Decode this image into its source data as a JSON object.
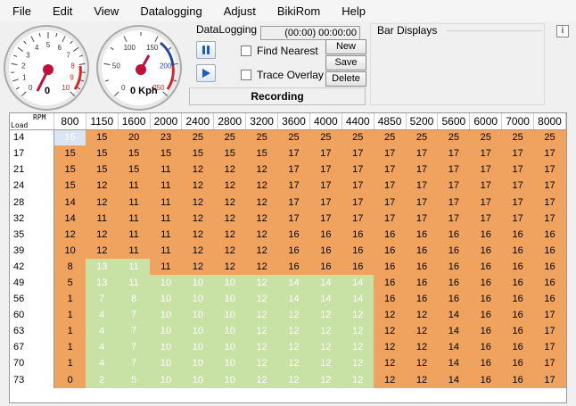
{
  "menu": [
    "File",
    "Edit",
    "View",
    "Datalogging",
    "Adjust",
    "BikiRom",
    "Help"
  ],
  "gauges": {
    "rpm": {
      "value": "0",
      "ticks": [
        "0",
        "1",
        "2",
        "3",
        "4",
        "5",
        "6",
        "7",
        "8",
        "9",
        "10"
      ]
    },
    "speed": {
      "value": "0 Kph",
      "ticks": [
        "0",
        "50",
        "100",
        "150",
        "200",
        "250"
      ]
    }
  },
  "datalogging": {
    "title": "DataLogging",
    "time": "(00:00) 00:00:00",
    "find_nearest": "Find Nearest",
    "trace_overlay": "Trace Overlay",
    "new": "New",
    "save": "Save",
    "delete": "Delete",
    "status": "Recording"
  },
  "bar_displays": {
    "title": "Bar Displays",
    "info": "i"
  },
  "table": {
    "corner_rpm": "RPM",
    "corner_load": "Load",
    "rpm": [
      "800",
      "1150",
      "1600",
      "2000",
      "2400",
      "2800",
      "3200",
      "3600",
      "4000",
      "4400",
      "4850",
      "5200",
      "5600",
      "6000",
      "7000",
      "8000"
    ],
    "loads": [
      "14",
      "17",
      "21",
      "24",
      "28",
      "32",
      "35",
      "39",
      "42",
      "49",
      "56",
      "60",
      "63",
      "67",
      "70",
      "73"
    ],
    "values": [
      [
        15,
        15,
        20,
        23,
        25,
        25,
        25,
        25,
        25,
        25,
        25,
        25,
        25,
        25,
        25,
        25
      ],
      [
        15,
        15,
        15,
        15,
        15,
        15,
        15,
        17,
        17,
        17,
        17,
        17,
        17,
        17,
        17,
        17
      ],
      [
        15,
        15,
        15,
        11,
        12,
        12,
        12,
        17,
        17,
        17,
        17,
        17,
        17,
        17,
        17,
        17
      ],
      [
        15,
        12,
        11,
        11,
        12,
        12,
        12,
        17,
        17,
        17,
        17,
        17,
        17,
        17,
        17,
        17
      ],
      [
        14,
        12,
        11,
        11,
        12,
        12,
        12,
        17,
        17,
        17,
        17,
        17,
        17,
        17,
        17,
        17
      ],
      [
        14,
        11,
        11,
        11,
        12,
        12,
        12,
        17,
        17,
        17,
        17,
        17,
        17,
        17,
        17,
        17
      ],
      [
        12,
        12,
        11,
        11,
        12,
        12,
        12,
        16,
        16,
        16,
        16,
        16,
        16,
        16,
        16,
        16
      ],
      [
        10,
        12,
        11,
        11,
        12,
        12,
        12,
        16,
        16,
        16,
        16,
        16,
        16,
        16,
        16,
        16
      ],
      [
        8,
        13,
        11,
        11,
        12,
        12,
        12,
        16,
        16,
        16,
        16,
        16,
        16,
        16,
        16,
        16
      ],
      [
        5,
        13,
        11,
        10,
        10,
        10,
        12,
        14,
        14,
        14,
        16,
        16,
        16,
        16,
        16,
        16
      ],
      [
        1,
        7,
        8,
        10,
        10,
        10,
        12,
        14,
        14,
        14,
        16,
        16,
        16,
        16,
        16,
        16
      ],
      [
        1,
        4,
        7,
        10,
        10,
        10,
        12,
        12,
        12,
        12,
        12,
        12,
        14,
        16,
        16,
        17
      ],
      [
        1,
        4,
        7,
        10,
        10,
        10,
        12,
        12,
        12,
        12,
        12,
        12,
        14,
        16,
        16,
        17
      ],
      [
        1,
        4,
        7,
        10,
        10,
        10,
        12,
        12,
        12,
        12,
        12,
        12,
        14,
        16,
        16,
        17
      ],
      [
        1,
        4,
        7,
        10,
        10,
        10,
        12,
        12,
        12,
        12,
        12,
        12,
        14,
        16,
        16,
        17
      ],
      [
        0,
        2,
        5,
        10,
        10,
        10,
        12,
        12,
        12,
        12,
        12,
        12,
        14,
        16,
        16,
        17
      ]
    ],
    "cell_colors": {
      "orange": "#f0a35e",
      "green": "#c8e2a5",
      "selected": "#dbe6f4"
    }
  }
}
